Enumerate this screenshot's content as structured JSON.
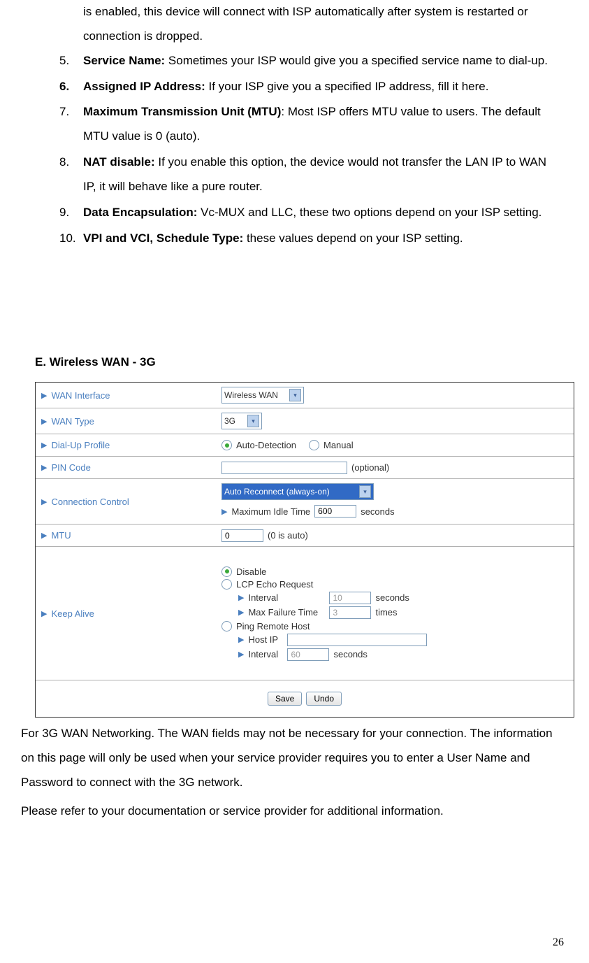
{
  "intro_tail": "is enabled, this device will connect with ISP automatically after system is restarted or connection is dropped.",
  "items": [
    {
      "num": "5.",
      "num_bold": false,
      "title": "Service Name:",
      "title_bold": true,
      "tail": " Sometimes your ISP would give you a specified service name to dial-up."
    },
    {
      "num": "6.",
      "num_bold": true,
      "title": "Assigned IP Address:",
      "title_bold": true,
      "tail": " If your ISP give you a specified IP address, fill it here."
    },
    {
      "num": "7.",
      "num_bold": false,
      "title": "Maximum Transmission Unit (MTU)",
      "title_bold": true,
      "tail": ": Most ISP offers MTU value to users. The default MTU value is 0 (auto)."
    },
    {
      "num": "8.",
      "num_bold": false,
      "title": "NAT disable:",
      "title_bold": true,
      "tail": " If you enable this option, the device would not transfer the LAN IP to WAN IP, it will behave like a pure router."
    },
    {
      "num": "9.",
      "num_bold": false,
      "title": "Data Encapsulation:",
      "title_bold": true,
      "tail": " Vc-MUX and LLC, these two options depend on your ISP setting."
    },
    {
      "num": "10.",
      "num_bold": false,
      "title": "VPI and VCI, Schedule Type:",
      "title_bold": true,
      "tail": " these values depend on your ISP setting."
    }
  ],
  "section_title": "E. Wireless WAN - 3G",
  "table": {
    "wan_interface": {
      "label": "WAN Interface",
      "value": "Wireless WAN"
    },
    "wan_type": {
      "label": "WAN Type",
      "value": "3G"
    },
    "dialup": {
      "label": "Dial-Up Profile",
      "opt_auto": "Auto-Detection",
      "opt_manual": "Manual"
    },
    "pin": {
      "label": "PIN Code",
      "hint": "(optional)"
    },
    "conn": {
      "label": "Connection Control",
      "value": "Auto Reconnect (always-on)",
      "sub_label": "Maximum Idle Time",
      "sub_value": "600",
      "unit": "seconds"
    },
    "mtu": {
      "label": "MTU",
      "value": "0",
      "hint": "(0 is auto)"
    },
    "keep": {
      "label": "Keep Alive",
      "opt_disable": "Disable",
      "opt_lcp": "LCP Echo Request",
      "lcp_interval_label": "Interval",
      "lcp_interval_val": "10",
      "lcp_interval_unit": "seconds",
      "lcp_fail_label": "Max Failure Time",
      "lcp_fail_val": "3",
      "lcp_fail_unit": "times",
      "opt_ping": "Ping Remote Host",
      "ping_host_label": "Host IP",
      "ping_interval_label": "Interval",
      "ping_interval_val": "60",
      "ping_interval_unit": "seconds"
    },
    "btn_save": "Save",
    "btn_undo": "Undo"
  },
  "para1": "For 3G WAN Networking. The WAN fields may not be necessary for your connection. The information on this page will only be used when your service provider requires you to enter a User Name and Password to connect with the 3G network.",
  "para2": "Please refer to your documentation or service provider for additional information.",
  "page_number": "26"
}
